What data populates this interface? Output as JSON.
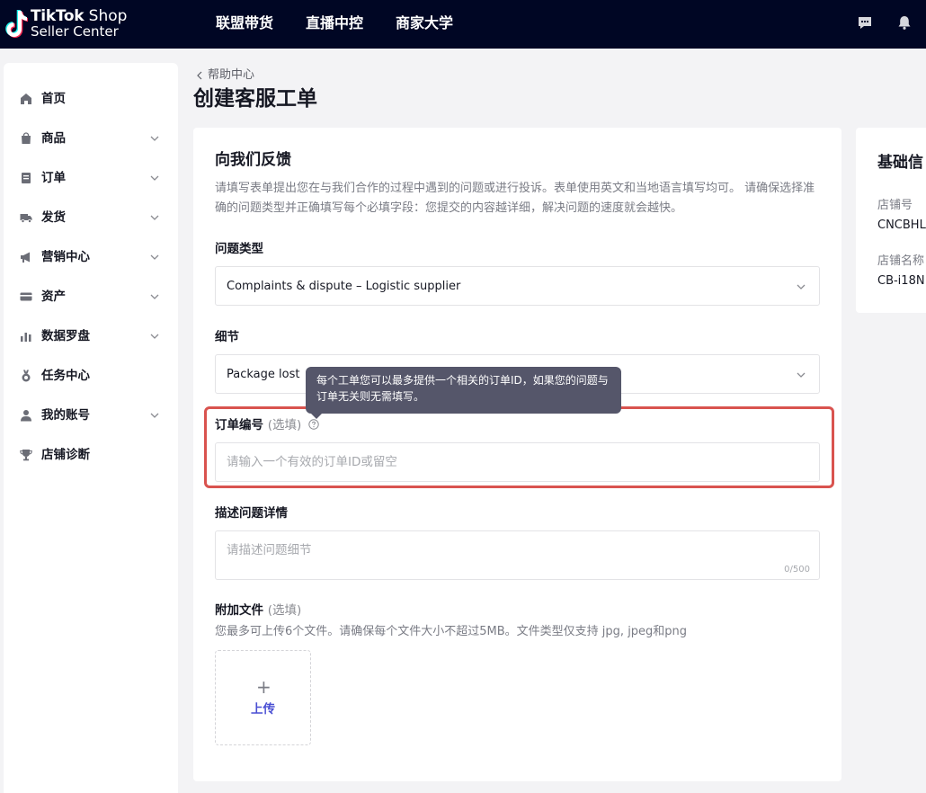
{
  "topbar": {
    "logo_line1_bold": "TikTok",
    "logo_line1_rest": " Shop",
    "logo_line2": "Seller Center",
    "nav": [
      "联盟带货",
      "直播中控",
      "商家大学"
    ]
  },
  "sidebar": {
    "items": [
      {
        "label": "首页",
        "icon": "home-icon",
        "expandable": false
      },
      {
        "label": "商品",
        "icon": "product-bag-icon",
        "expandable": true
      },
      {
        "label": "订单",
        "icon": "order-doc-icon",
        "expandable": true
      },
      {
        "label": "发货",
        "icon": "truck-icon",
        "expandable": true
      },
      {
        "label": "营销中心",
        "icon": "megaphone-icon",
        "expandable": true
      },
      {
        "label": "资产",
        "icon": "card-icon",
        "expandable": true
      },
      {
        "label": "数据罗盘",
        "icon": "bar-chart-icon",
        "expandable": true
      },
      {
        "label": "任务中心",
        "icon": "medal-icon",
        "expandable": false
      },
      {
        "label": "我的账号",
        "icon": "user-icon",
        "expandable": true
      },
      {
        "label": "店铺诊断",
        "icon": "trophy-icon",
        "expandable": false
      }
    ]
  },
  "header": {
    "breadcrumb": "帮助中心",
    "title": "创建客服工单"
  },
  "form": {
    "section_title": "向我们反馈",
    "description": "请填写表单提出您在与我们合作的过程中遇到的问题或进行投诉。表单使用英文和当地语言填写均可。 请确保选择准确的问题类型并正确填写每个必填字段：您提交的内容越详细，解决问题的速度就会越快。",
    "issue_type_label": "问题类型",
    "issue_type_value": "Complaints & dispute – Logistic supplier",
    "detail_label": "细节",
    "detail_value": "Package lost",
    "order_id_label": "订单编号",
    "optional_text": "(选填)",
    "order_id_placeholder": "请输入一个有效的订单ID或留空",
    "tooltip_line1": "每个工单您可以最多提供一个相关的订单ID，如果您的问题与",
    "tooltip_line2": "订单无关则无需填写。",
    "describe_label": "描述问题详情",
    "describe_placeholder": "请描述问题细节",
    "describe_counter": "0/500",
    "attach_label": "附加文件",
    "attach_hint": "您最多可上传6个文件。请确保每个文件大小不超过5MB。文件类型仅支持 jpg, jpeg和png",
    "upload_plus": "+",
    "upload_label": "上传"
  },
  "info": {
    "title": "基础信",
    "store_id_label": "店铺号",
    "store_id_value": "CNCBHL",
    "store_name_label": "店铺名称",
    "store_name_value": "CB-i18N"
  },
  "colors": {
    "topbar_bg": "#000624",
    "highlight_border": "#d9534f",
    "upload_accent": "#4a4fd3",
    "tooltip_bg": "#55566a"
  }
}
